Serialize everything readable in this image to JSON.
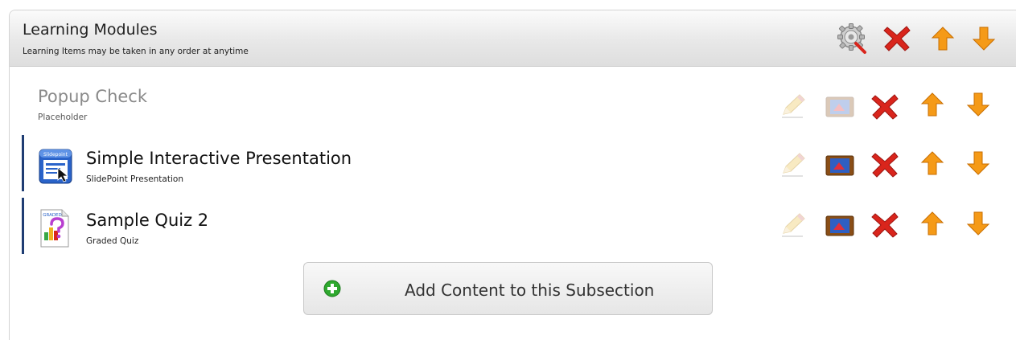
{
  "header": {
    "title": "Learning Modules",
    "subtitle": "Learning Items may be taken in any order at anytime",
    "actions": [
      "settings-icon",
      "delete-icon",
      "move-up-icon",
      "move-down-icon"
    ]
  },
  "items": [
    {
      "title": "Popup Check",
      "subtitle": "Placeholder",
      "title_color": "#8a8a8a",
      "subtitle_color": "#555555",
      "state": "disabled"
    },
    {
      "title": "Simple Interactive Presentation",
      "subtitle": "SlidePoint Presentation",
      "type_icon": "slidepoint-presentation-icon",
      "type_icon_text": "Slidepoint",
      "state": "active"
    },
    {
      "title": "Sample Quiz 2",
      "subtitle": "Graded Quiz",
      "type_icon": "graded-quiz-icon",
      "type_icon_text": "GRADED",
      "state": "active"
    }
  ],
  "add_button": {
    "label": "Add Content to this Subsection",
    "icon": "plus-icon"
  },
  "colors": {
    "accent_bar": "#1f3d73",
    "delete_red": "#d9251c",
    "arrow_orange": "#f59a17",
    "add_green": "#2ea82e"
  }
}
